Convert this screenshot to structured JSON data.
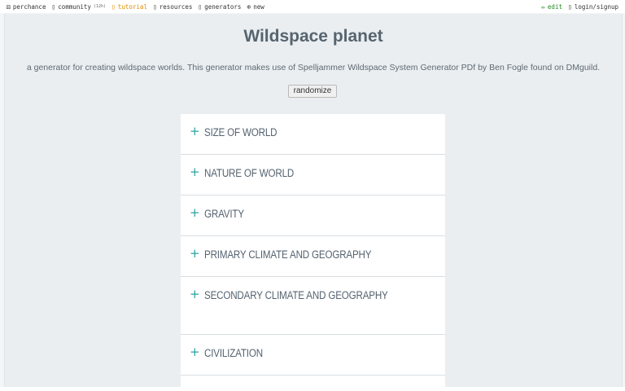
{
  "topbar": {
    "left": [
      {
        "name": "perchance",
        "icon": "dice-icon",
        "glyph": "⚄",
        "label": "perchance"
      },
      {
        "name": "community",
        "icon": "chat-icon",
        "glyph": "▯",
        "label": "community",
        "badge": "(12h)"
      },
      {
        "name": "tutorial",
        "icon": "book-icon",
        "glyph": "▯",
        "label": "tutorial"
      },
      {
        "name": "resources",
        "icon": "book-icon",
        "glyph": "▯",
        "label": "resources"
      },
      {
        "name": "generators",
        "icon": "list-icon",
        "glyph": "▯",
        "label": "generators"
      },
      {
        "name": "new",
        "icon": "plus-circle-icon",
        "glyph": "⊕",
        "label": "new"
      }
    ],
    "right": [
      {
        "name": "edit",
        "icon": "pencil-icon",
        "glyph": "✏",
        "label": "edit"
      },
      {
        "name": "login",
        "icon": "user-icon",
        "glyph": "▯",
        "label": "login/signup"
      }
    ],
    "colors": {
      "tutorial": "#e08a00",
      "edit": "#1c8a1c"
    }
  },
  "page": {
    "title": "Wildspace planet",
    "description": "a generator for creating wildspace worlds. This generator makes use of Spelljammer Wildspace System Generator PDf by Ben Fogle found on DMguild.",
    "randomize_label": "randomize"
  },
  "accordion": {
    "accent_color": "#2aa3a3",
    "plus_glyph": "+",
    "sections": [
      {
        "label": "SIZE OF WORLD"
      },
      {
        "label": "NATURE OF WORLD"
      },
      {
        "label": "GRAVITY"
      },
      {
        "label": "PRIMARY CLIMATE AND GEOGRAPHY"
      },
      {
        "label": "SECONDARY CLIMATE AND GEOGRAPHY"
      },
      {
        "label": "CIVILIZATION"
      }
    ]
  }
}
